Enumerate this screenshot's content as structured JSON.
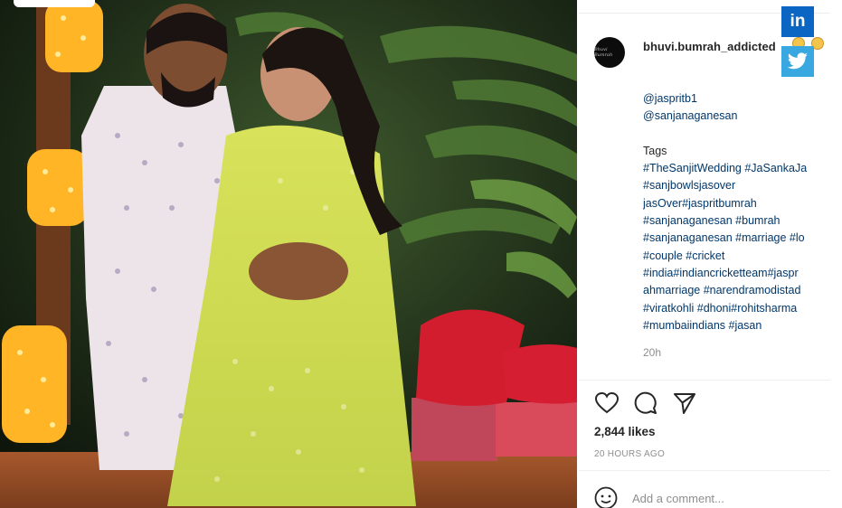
{
  "post": {
    "username": "bhuvi.bumrah_addicted",
    "avatar_text": "Bhuvi Bumrah",
    "caption_lines": [
      {
        "text": "@jaspritb1",
        "kind": "link"
      },
      {
        "text": "@sanjanaganesan",
        "kind": "link"
      },
      {
        "text": "",
        "kind": "spacer"
      },
      {
        "text": "Tags",
        "kind": "plain"
      },
      {
        "text": "#TheSanjitWedding #JaSankaJa",
        "kind": "link"
      },
      {
        "text": "#sanjbowlsjasover",
        "kind": "link"
      },
      {
        "text": "jasOver#jaspritbumrah",
        "kind": "link"
      },
      {
        "text": "#sanjanaganesan #bumrah",
        "kind": "link"
      },
      {
        "text": "#sanjanaganesan #marriage #lo",
        "kind": "link"
      },
      {
        "text": "#couple #cricket",
        "kind": "link"
      },
      {
        "text": "#india#indiancricketteam#jaspr",
        "kind": "link"
      },
      {
        "text": "ahmarriage #narendramodistad",
        "kind": "link"
      },
      {
        "text": "#viratkohli #dhoni#rohitsharma",
        "kind": "link"
      },
      {
        "text": "#mumbaiindians #jasan",
        "kind": "link"
      }
    ],
    "caption_time": "20h",
    "likes": "2,844 likes",
    "posted_ago": "20 HOURS AGO",
    "comment_placeholder": "Add a comment..."
  },
  "icons": {
    "like": "heart-icon",
    "comment": "comment-bubble-icon",
    "share": "send-arrow-icon",
    "emoji": "smiley-icon",
    "emoji_faces": "grin-emoji-icon"
  },
  "share_buttons": {
    "linkedin": {
      "label": "in",
      "color": "#0a66c2"
    },
    "twitter": {
      "color": "#3aa8e0"
    }
  }
}
